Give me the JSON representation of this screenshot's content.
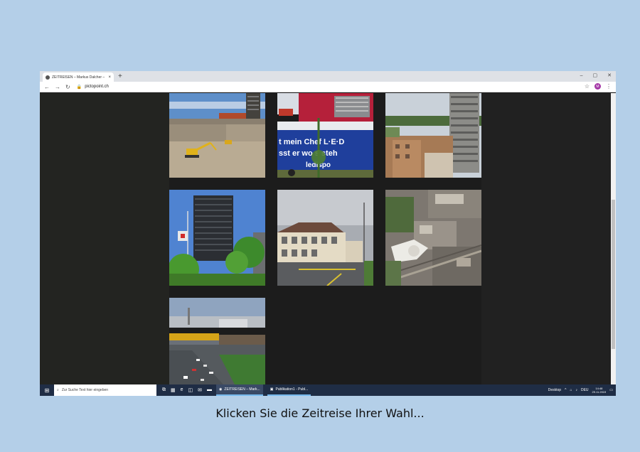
{
  "browser": {
    "tab_title": "ZEITREISEN – Markus Dalcher – ",
    "tab_close": "×",
    "new_tab": "+",
    "url": "pictopoint.ch",
    "avatar_letter": "M",
    "controls": {
      "minimize": "–",
      "maximize": "▢",
      "close": "✕"
    }
  },
  "gallery": {
    "photos": [
      {
        "name": "construction-site",
        "desc": "Baustelle mit Bagger"
      },
      {
        "name": "red-building-truck",
        "desc": "Rotes Gebäude mit LKW"
      },
      {
        "name": "tower-residential",
        "desc": "Hochhaus und Wohnhäuser"
      },
      {
        "name": "tower-flag",
        "desc": "Hochhaus mit Fahne"
      },
      {
        "name": "school-building",
        "desc": "Schulhaus"
      },
      {
        "name": "aerial-view",
        "desc": "Luftaufnahme"
      },
      {
        "name": "highway",
        "desc": "Autobahn"
      }
    ]
  },
  "taskbar": {
    "search_placeholder": "Zur Suche Text hier eingeben",
    "tasks": [
      "ZEITREISEN – Mark...",
      "Publikation1 - Publ..."
    ],
    "desktop_label": "Desktop",
    "language": "DEU",
    "time": "14:48",
    "date": "29.11.2019"
  },
  "caption": "Klicken Sie die Zeitreise Ihrer Wahl...",
  "colors": {
    "background": "#b4cfe8",
    "taskbar": "#1f2d45",
    "page": "#1c1c1c"
  }
}
